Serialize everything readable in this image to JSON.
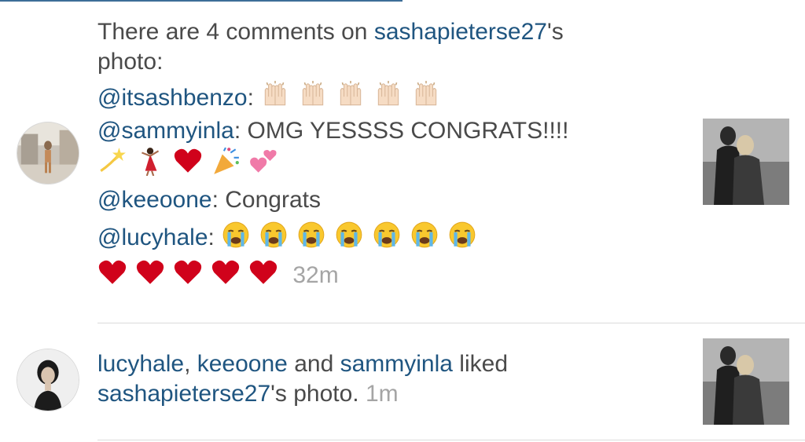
{
  "notification_1": {
    "intro_prefix": "There are 4 comments on ",
    "intro_user": "sashapieterse27",
    "intro_suffix": "'s",
    "intro_line2": "photo:",
    "comments": [
      {
        "user": "@itsashbenzo",
        "sep": ": ",
        "text": "",
        "emojis": [
          "raised-hands",
          "raised-hands",
          "raised-hands",
          "raised-hands",
          "raised-hands"
        ]
      },
      {
        "user": "@sammyinla",
        "sep": ": ",
        "text": "OMG YESSSS CONGRATS!!!!",
        "emojis": [
          "dizzy",
          "dancer",
          "red-heart",
          "party-popper",
          "two-hearts"
        ]
      },
      {
        "user": "@keeoone",
        "sep": ": ",
        "text": "Congrats",
        "emojis": []
      },
      {
        "user": "@lucyhale",
        "sep": ": ",
        "text": "",
        "emojis": [
          "loudly-crying-face",
          "loudly-crying-face",
          "loudly-crying-face",
          "loudly-crying-face",
          "loudly-crying-face",
          "loudly-crying-face",
          "loudly-crying-face"
        ],
        "emojis_line2": [
          "red-heart",
          "red-heart",
          "red-heart",
          "red-heart",
          "red-heart"
        ]
      }
    ],
    "time": "32m"
  },
  "notification_2": {
    "user1": "lucyhale",
    "comma": ", ",
    "user2": "keeoone",
    "and": " and ",
    "user3": "sammyinla",
    "liked": " liked",
    "owner": "sashapieterse27",
    "suffix": "'s photo. ",
    "time": "1m"
  },
  "colors": {
    "link": "#1f5580",
    "text": "#4a4a4a",
    "muted": "#a5a5a5",
    "divider": "#dbdbdb",
    "heart": "#d0021b"
  }
}
